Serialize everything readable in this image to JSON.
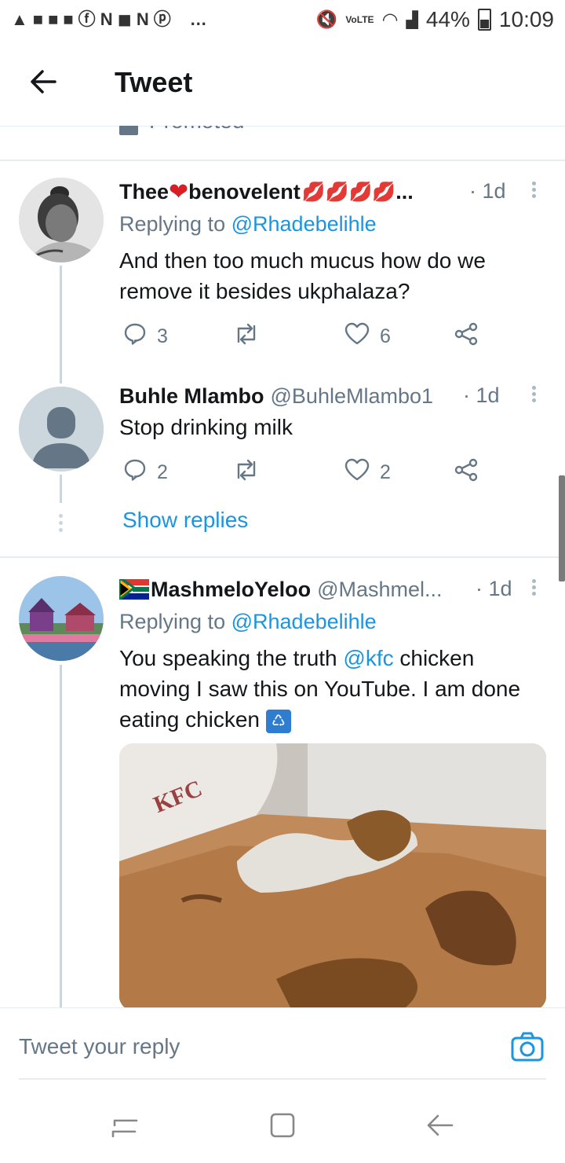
{
  "status_bar": {
    "left_icons": [
      "warning-icon",
      "message-icon",
      "message-icon",
      "message-icon",
      "facebook-icon",
      "n-icon",
      "mail-icon",
      "n-icon",
      "pinterest-icon",
      "more-notifications-icon"
    ],
    "network_label": "VoLTE",
    "battery": "44%",
    "time": "10:09"
  },
  "header": {
    "title": "Tweet",
    "promoted_label": "Promoted"
  },
  "tweets": [
    {
      "name": "Thee",
      "name_mid": "benovelent",
      "name_ellipsis": "...",
      "time": "· 1d",
      "replying_prefix": "Replying to",
      "replying_handle": "@Rhadebelihle",
      "text": "And then too much mucus how do we remove it besides ukphalaza?",
      "reply_count": "3",
      "like_count": "6"
    },
    {
      "name": "Buhle Mlambo",
      "handle": "@BuhleMlambo1",
      "time": "· 1d",
      "text": "Stop drinking milk",
      "reply_count": "2",
      "like_count": "2",
      "show_replies": "Show replies"
    },
    {
      "name": "MashmeloYeloo",
      "handle": "@Mashmel...",
      "time": "· 1d",
      "replying_prefix": "Replying to",
      "replying_handle": "@Rhadebelihle",
      "text_part1": "You speaking the truth ",
      "text_mention": "@kfc",
      "text_part2": "  chicken moving I saw this on YouTube. I  am done eating chicken",
      "media_text": "KFC"
    }
  ],
  "composer": {
    "placeholder": "Tweet your reply"
  },
  "colors": {
    "link": "#1b95e0",
    "muted": "#657786",
    "divider": "#e6ecf0"
  }
}
